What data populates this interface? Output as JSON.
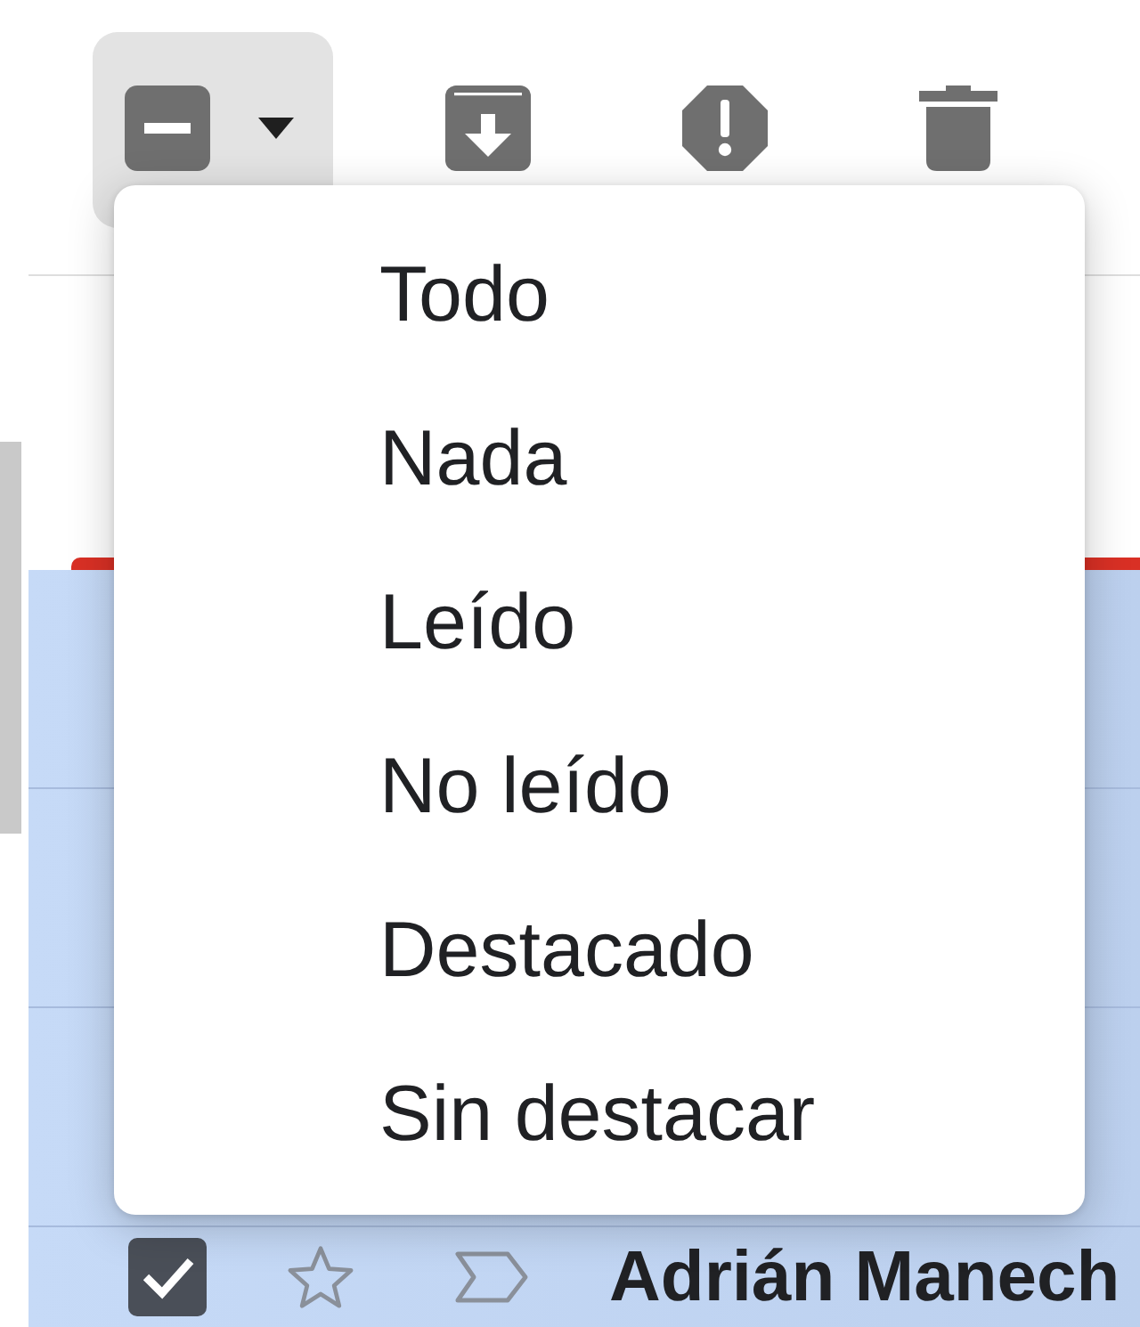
{
  "toolbar": {
    "select": {
      "indeterminate": true,
      "expanded": true
    },
    "actions": [
      {
        "kind": "archive"
      },
      {
        "kind": "spam"
      },
      {
        "kind": "delete"
      }
    ]
  },
  "select_menu": {
    "items": [
      {
        "label": "Todo"
      },
      {
        "label": "Nada"
      },
      {
        "label": "Leído"
      },
      {
        "label": "No leído"
      },
      {
        "label": "Destacado"
      },
      {
        "label": "Sin destacar"
      }
    ]
  },
  "email_rows": [
    {
      "selected": true
    },
    {
      "selected": true
    },
    {
      "selected": true
    },
    {
      "selected": true,
      "checked": true,
      "starred": false,
      "important": false,
      "sender": "Adrián Manech"
    }
  ]
}
